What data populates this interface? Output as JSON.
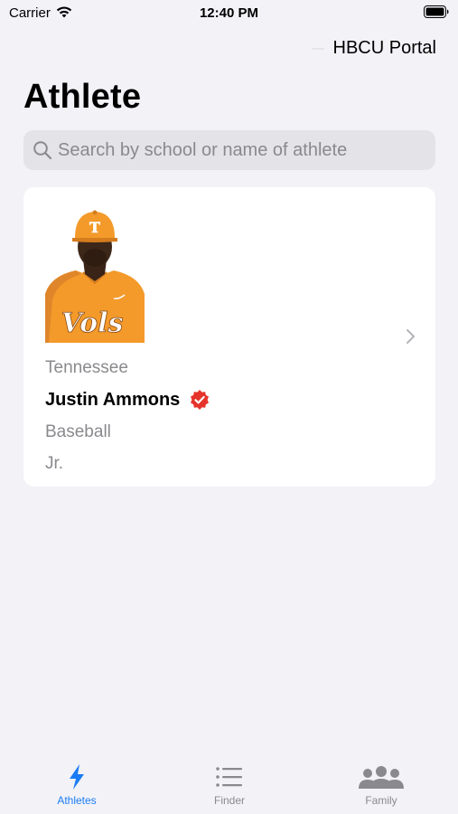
{
  "status_bar": {
    "carrier": "Carrier",
    "time": "12:40 PM"
  },
  "nav": {
    "portal_label": "HBCU Portal"
  },
  "page": {
    "title": "Athlete"
  },
  "search": {
    "placeholder": "Search by school or name of athlete",
    "value": ""
  },
  "athletes": [
    {
      "school": "Tennessee",
      "name": "Justin Ammons",
      "sport": "Baseball",
      "year": "Jr.",
      "verified": true,
      "jersey_text": "Vols",
      "cap_letter": "T"
    }
  ],
  "tabs": [
    {
      "label": "Athletes",
      "icon": "bolt-icon",
      "active": true
    },
    {
      "label": "Finder",
      "icon": "list-icon",
      "active": false
    },
    {
      "label": "Family",
      "icon": "people-icon",
      "active": false
    }
  ],
  "colors": {
    "accent": "#1a7cf5",
    "background": "#f2f2f7",
    "verified": "#e5332a",
    "jersey_orange": "#f39a2b"
  }
}
